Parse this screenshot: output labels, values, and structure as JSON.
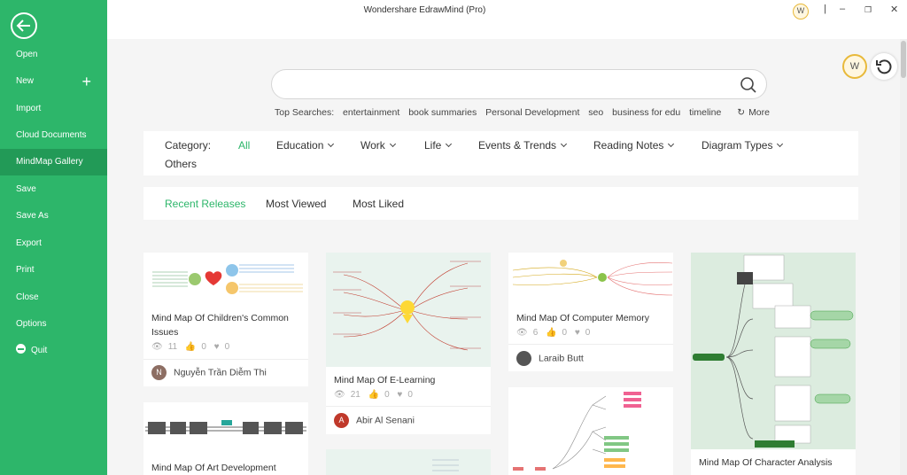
{
  "app": {
    "title": "Wondershare EdrawMind (Pro)",
    "user_initial": "W"
  },
  "sidebar": {
    "items": [
      {
        "label": "Open"
      },
      {
        "label": "New"
      },
      {
        "label": "Import"
      },
      {
        "label": "Cloud Documents"
      },
      {
        "label": "MindMap Gallery"
      },
      {
        "label": "Save"
      },
      {
        "label": "Save As"
      },
      {
        "label": "Export"
      },
      {
        "label": "Print"
      },
      {
        "label": "Close"
      },
      {
        "label": "Options"
      },
      {
        "label": "Quit"
      }
    ],
    "active": "MindMap Gallery"
  },
  "window_controls": {
    "minimize": "–",
    "restore": "❐",
    "close": "✕"
  },
  "search": {
    "placeholder": "",
    "top_searches_label": "Top Searches:",
    "top_searches": [
      "entertainment",
      "book summaries",
      "Personal Development",
      "seo",
      "business for edu",
      "timeline"
    ],
    "more": "More"
  },
  "category": {
    "label": "Category:",
    "items": [
      "All",
      "Education",
      "Work",
      "Life",
      "Events & Trends",
      "Reading Notes",
      "Diagram Types",
      "Others"
    ],
    "active": "All"
  },
  "sort_tabs": {
    "items": [
      "Recent Releases",
      "Most Viewed",
      "Most Liked"
    ],
    "active": "Recent Releases"
  },
  "cards": [
    {
      "title": "Mind Map Of Children's Common Issues",
      "views": "11",
      "likes": "0",
      "hearts": "0",
      "author": "Nguyễn Trần Diễm Thi",
      "author_initial": "N",
      "avatar_color": "#8d6e63"
    },
    {
      "title": "Mind Map Of E-Learning",
      "views": "21",
      "likes": "0",
      "hearts": "0",
      "author": "Abir Al Senani",
      "author_initial": "A",
      "avatar_color": "#c0392b"
    },
    {
      "title": "Mind Map Of Computer Memory",
      "views": "6",
      "likes": "0",
      "hearts": "0",
      "author": "Laraib Butt",
      "author_initial": "",
      "avatar_color": "#555555"
    },
    {
      "title": "Mind Map Of Character Analysis"
    },
    {
      "title": "Mind Map Of Art Development"
    }
  ],
  "colors": {
    "brand": "#2db66a",
    "brand_dark": "#229a57"
  }
}
